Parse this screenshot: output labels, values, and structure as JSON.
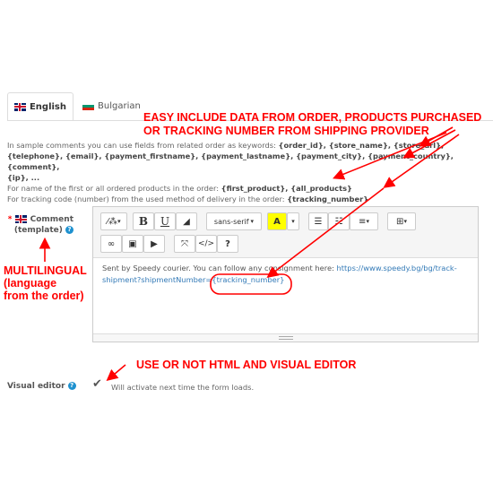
{
  "tabs": [
    {
      "label": "English",
      "active": true,
      "flag": "uk-flag-icon"
    },
    {
      "label": "Bulgarian",
      "active": false,
      "flag": "bulgaria-flag-icon"
    }
  ],
  "annotations": {
    "top_line1": "EASY INCLUDE DATA FROM ORDER, PRODUCTS PURCHASED",
    "top_line2": "OR TRACKING NUMBER FROM SHIPPING PROVIDER",
    "multilingual_line1": "MULTILINGUAL",
    "multilingual_line2": "(language",
    "multilingual_line3": "from the order)",
    "editor_note": "USE OR NOT HTML AND VISUAL EDITOR"
  },
  "info": {
    "line1_prefix": "In sample comments you can use fields from related order as keywords: ",
    "line1_keywords": "{order_id}, {store_name}, {store_url},",
    "line2_keywords": "{telephone}, {email}, {payment_firstname}, {payment_lastname}, {payment_city}, {payment_country}, {comment},",
    "line3_keywords": "{ip}, ...",
    "line4_prefix": "For name of the first or all ordered products in the order: ",
    "line4_keywords": "{first_product}, {all_products}",
    "line5_prefix": "For tracking code (number) from the used method of delivery in the order: ",
    "line5_keywords": "{tracking_number}"
  },
  "comment_field": {
    "required_mark": "*",
    "label": "Comment",
    "sublabel": "(template)",
    "help": "?"
  },
  "toolbar": {
    "bold": "B",
    "underline": "U",
    "font": "sans-serif",
    "color_letter": "A",
    "help": "?"
  },
  "editor_content": {
    "text": "Sent by Speedy courier. You can follow any consignment here: ",
    "link_part1": "https://www.speedy.bg/bg/track-",
    "link_part2": "shipment?shipmentNumber=",
    "token": "{tracking_number}"
  },
  "visual_editor": {
    "label": "Visual editor",
    "help": "?",
    "checked": true,
    "hint": "Will activate next time the form loads."
  },
  "colors": {
    "annotation_red": "#ff0000",
    "link_blue": "#337ab7",
    "help_blue": "#1e91cf"
  }
}
